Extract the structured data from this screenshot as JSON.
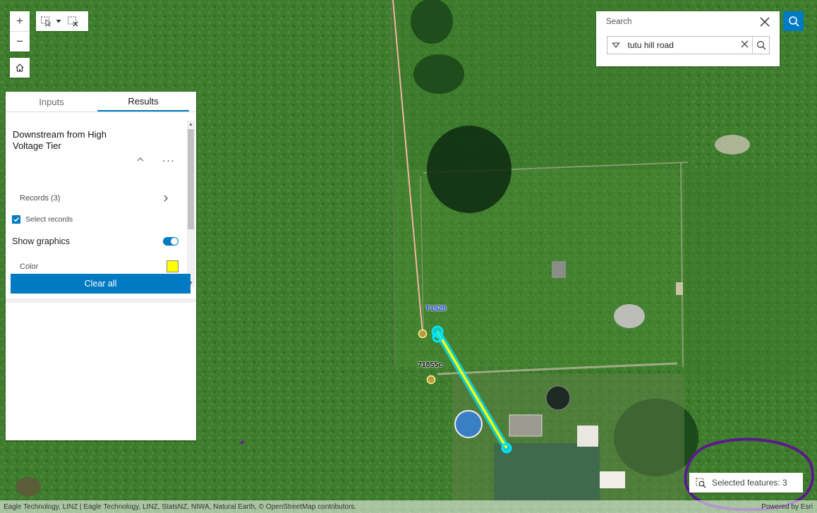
{
  "map": {
    "labels": [
      {
        "id": "t1526",
        "text": "T1526",
        "color": "#1f3cff"
      },
      {
        "id": "p71855",
        "text": "71855c",
        "color": "#111111"
      }
    ],
    "trace_color": "#ffff00",
    "highlight_color": "#00e5ff"
  },
  "toolbar": {
    "zoom_in": "+",
    "zoom_out": "−"
  },
  "panel": {
    "tabs": [
      {
        "label": "Inputs",
        "active": false
      },
      {
        "label": "Results",
        "active": true
      }
    ],
    "group_title": "Downstream from High Voltage Tier",
    "more": "···",
    "records_label": "Records (3)",
    "select_records_label": "Select records",
    "select_records_checked": true,
    "show_graphics_label": "Show graphics",
    "show_graphics_on": true,
    "color_label": "Color",
    "color_value": "#ffff00",
    "clear_button": "Clear all"
  },
  "search": {
    "title": "Search",
    "value": "tutu hill road"
  },
  "selection": {
    "label": "Selected features: 3"
  },
  "attribution": {
    "left": "Eagle Technology, LINZ | Eagle Technology, LINZ, StatsNZ, NIWA, Natural Earth, © OpenStreetMap contributors.",
    "right": "Powered by Esri"
  },
  "colors": {
    "accent": "#007ac2",
    "annotation": "#5a1a8c"
  }
}
